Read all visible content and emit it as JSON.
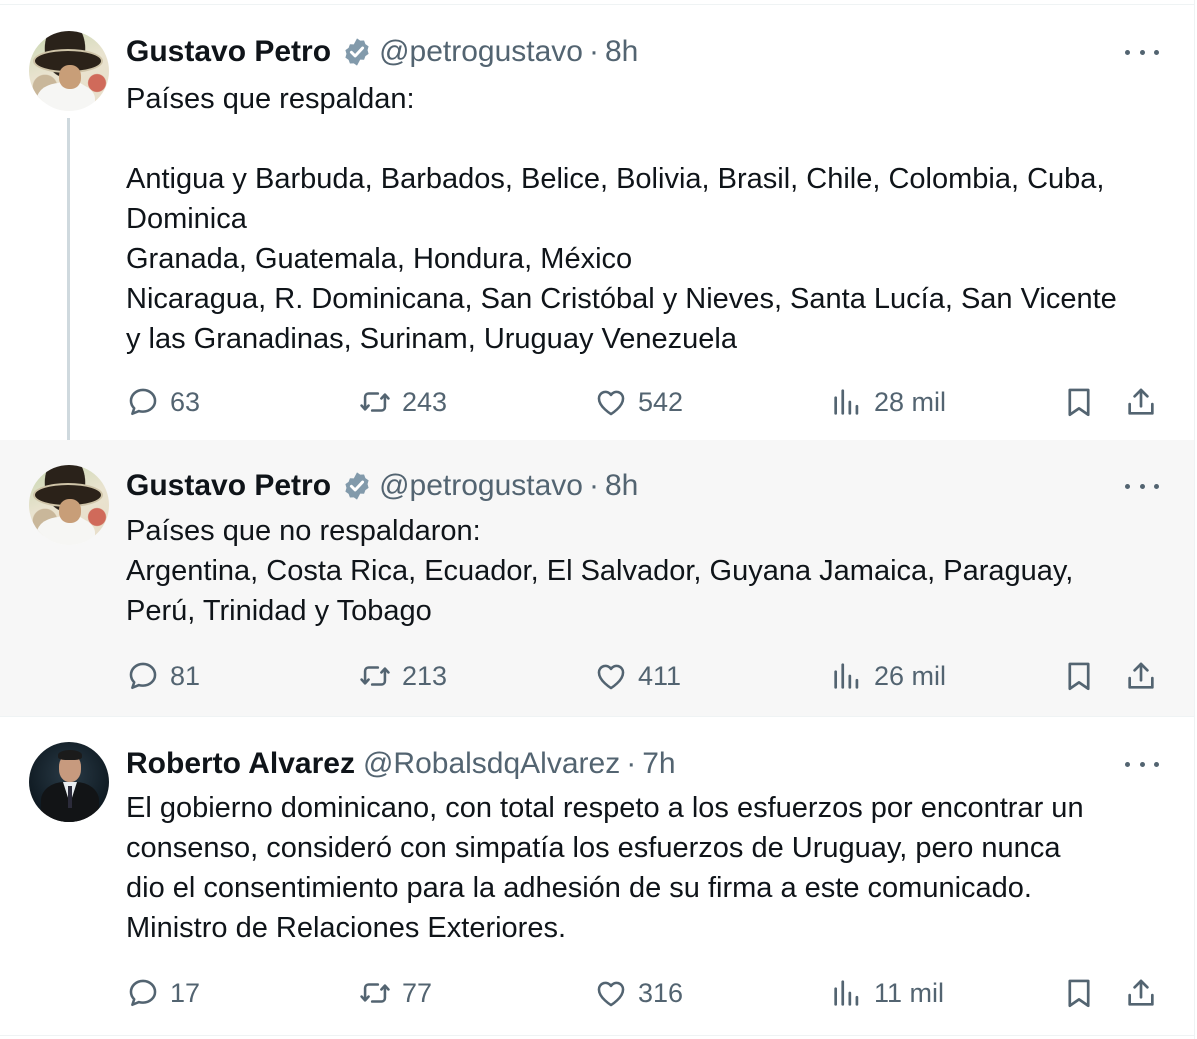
{
  "tweets": [
    {
      "name": "Gustavo Petro",
      "handle": "@petrogustavo",
      "dot": "·",
      "time": "8h",
      "text": "Países que respaldan:\n\nAntigua y Barbuda, Barbados, Belice, Bolivia, Brasil, Chile, Colombia, Cuba,\nDominica\nGranada, Guatemala, Hondura, México\nNicaragua, R. Dominicana, San Cristóbal y Nieves, Santa Lucía, San Vicente\ny las Granadinas, Surinam, Uruguay Venezuela",
      "replies": "63",
      "reposts": "243",
      "likes": "542",
      "views": "28 mil",
      "verified": true
    },
    {
      "name": "Gustavo Petro",
      "handle": "@petrogustavo",
      "dot": "·",
      "time": "8h",
      "text": "Países que no respaldaron:\nArgentina, Costa Rica, Ecuador, El Salvador, Guyana Jamaica, Paraguay,\nPerú, Trinidad y Tobago",
      "replies": "81",
      "reposts": "213",
      "likes": "411",
      "views": "26 mil",
      "verified": true
    },
    {
      "name": "Roberto Alvarez",
      "handle": "@RobalsdqAlvarez",
      "dot": "·",
      "time": "7h",
      "text": "El gobierno dominicano, con total respeto a los esfuerzos por encontrar un\nconsenso, consideró con simpatía los esfuerzos de Uruguay, pero nunca\ndio el consentimiento para la adhesión de su firma a este comunicado.\nMinistro de Relaciones Exteriores.",
      "replies": "17",
      "reposts": "77",
      "likes": "316",
      "views": "11 mil",
      "verified": false
    }
  ],
  "icons": {
    "reply": "reply-icon",
    "repost": "repost-icon",
    "like": "heart-icon",
    "views": "views-icon",
    "bookmark": "bookmark-icon",
    "share": "share-icon",
    "more": "more-icon",
    "verified": "verified-badge-icon"
  },
  "colors": {
    "text": "#0f1419",
    "secondary": "#536471",
    "verified": "#829aab",
    "highlight_bg": "#f7f7f7",
    "border": "#eff3f4"
  }
}
